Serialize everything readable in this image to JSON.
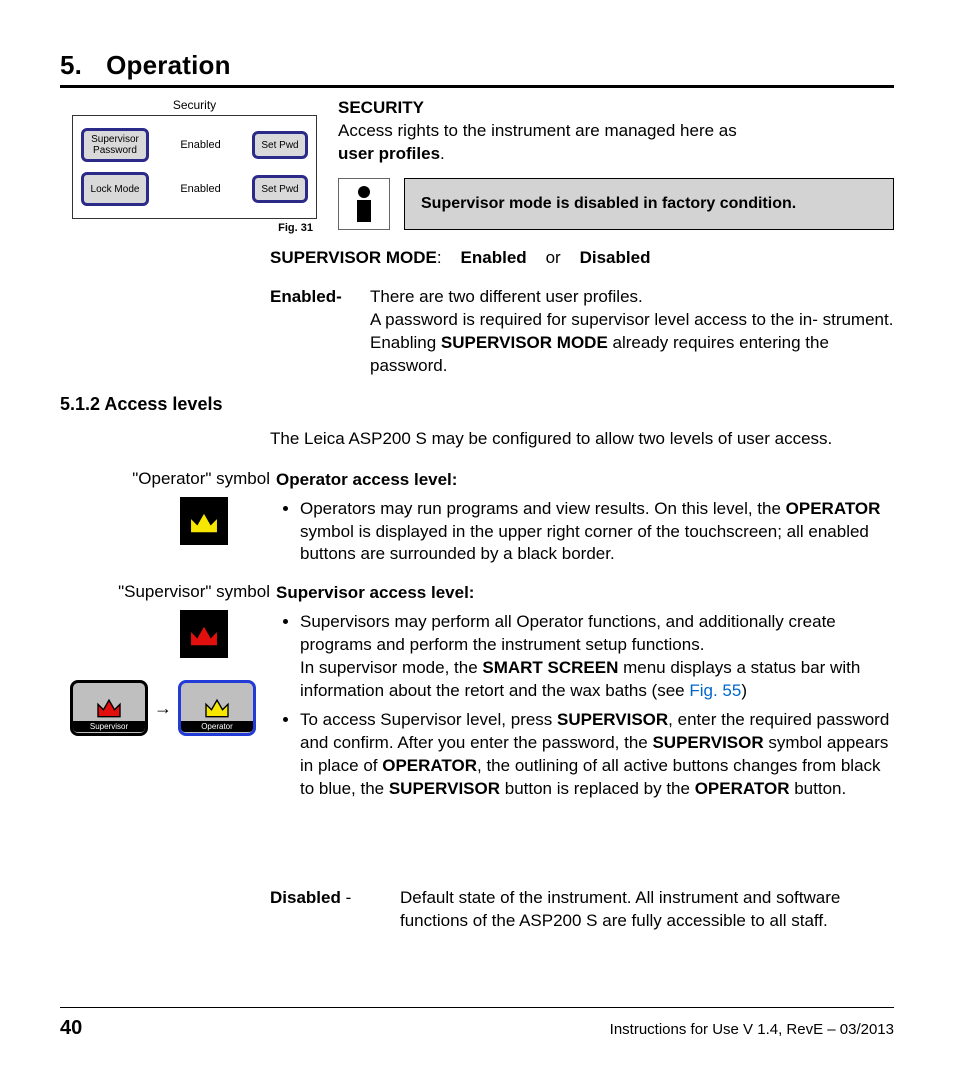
{
  "chapter": {
    "number": "5.",
    "title": "Operation"
  },
  "security_panel": {
    "title": "Security",
    "rows": [
      {
        "button": "Supervisor\nPassword",
        "status": "Enabled",
        "action": "Set Pwd"
      },
      {
        "button": "Lock Mode",
        "status": "Enabled",
        "action": "Set Pwd"
      }
    ],
    "caption": "Fig. 31"
  },
  "security_section": {
    "heading": "SECURITY",
    "line1": "Access rights to the instrument are managed here as",
    "bold_term": "user profiles",
    "period": ".",
    "note": "Supervisor mode is disabled in factory condition.",
    "mode_label": "SUPERVISOR MODE",
    "colon": ":",
    "option1": "Enabled",
    "or": "or",
    "option2": "Disabled"
  },
  "enabled_def": {
    "term": "Enabled",
    "dash": "-",
    "l1": "There are two different user profiles.",
    "l2a": "A password is required for supervisor level access to the in- strument. Enabling ",
    "l2b": "SUPERVISOR MODE",
    "l2c": " already requires entering the password."
  },
  "access_section": {
    "heading": "5.1.2 Access levels",
    "intro": "The Leica ASP200 S may be configured to allow two levels of user access."
  },
  "operator": {
    "label": "\"Operator\" symbol",
    "heading": "Operator access level:",
    "b1a": "Operators may run programs and view results. On this level, the ",
    "b1b": "OPERATOR",
    "b1c": " symbol is displayed in the upper right corner of the touchscreen; all enabled buttons are surrounded by a black border."
  },
  "supervisor": {
    "label": "\"Supervisor\" symbol",
    "heading": "Supervisor access level:",
    "b1a": "Supervisors may perform all Operator functions, and additionally create programs and perform the instrument setup functions.",
    "b1b_pre": "In supervisor mode, the ",
    "b1b_bold": "SMART SCREEN",
    "b1b_post": " menu displays a status bar with information about the retort and the wax baths (see ",
    "b1b_link": "Fig. 55",
    "b1b_close": ")",
    "b2a": "To access Supervisor level, press ",
    "b2b": "SUPERVISOR",
    "b2c": ", enter the required password and confirm. After you enter the password, the ",
    "b2d": "SUPERVISOR",
    "b2e": " symbol appears in place of ",
    "b2f": "OPERATOR",
    "b2g": ", the outlining of all active buttons changes from black to blue, the ",
    "b2h": "SUPERVISOR",
    "b2i": " button is replaced by the ",
    "b2j": "OPERATOR",
    "b2k": " button."
  },
  "btn_pair": {
    "left": "Supervisor",
    "right": "Operator",
    "arrow": "→"
  },
  "disabled_def": {
    "term": "Disabled",
    "dash": " - ",
    "body": "Default state of the instrument. All instrument and software functions of the ASP200 S are fully accessible to all staff."
  },
  "footer": {
    "page": "40",
    "right": "Instructions for Use V 1.4, RevE – 03/2013"
  }
}
